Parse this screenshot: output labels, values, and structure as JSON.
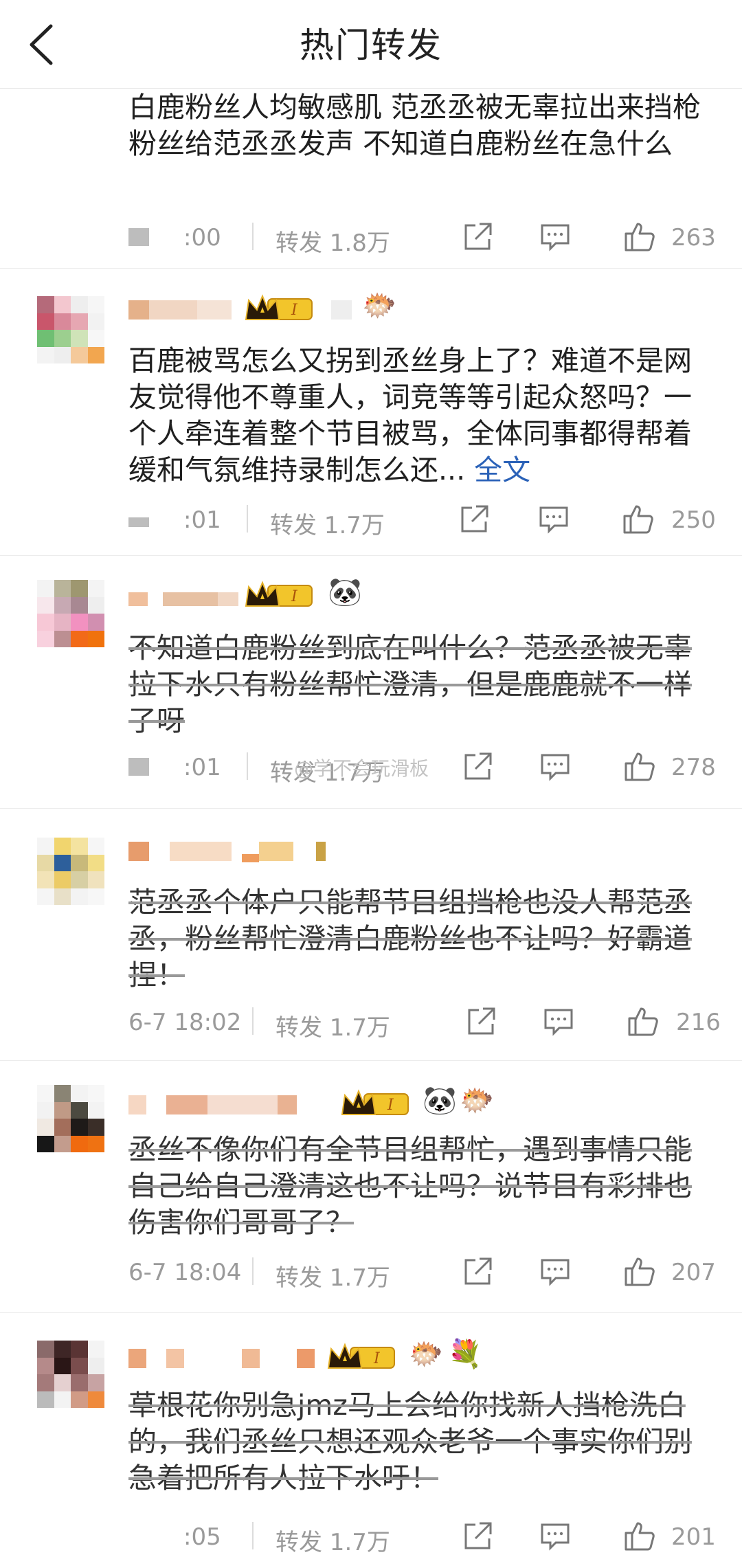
{
  "header": {
    "title": "热门转发"
  },
  "watermark": "@学不会玩滑板",
  "posts": [
    {
      "content": "白鹿粉丝人均敏感肌 范丞丞被无辜拉出来挡枪 粉丝给范丞丞发声 不知道白鹿粉丝在急什么",
      "time": ":00",
      "reposts": "转发 1.8万",
      "likes": "263"
    },
    {
      "content": "百鹿被骂怎么又拐到丞丝身上了？难道不是网友觉得他不尊重人，词竞等等引起众怒吗？一个人牵连着整个节目被骂，全体同事都得帮着缓和气氛维持录制怎么还...",
      "full_text_label": "全文",
      "time": ":01",
      "reposts": "转发 1.7万",
      "likes": "250"
    },
    {
      "content": "不知道白鹿粉丝到底在叫什么？范丞丞被无辜拉下水只有粉丝帮忙澄清，但是鹿鹿就不一样了呀",
      "time": ":01",
      "reposts": "转发 1.7万",
      "likes": "278"
    },
    {
      "content": "范丞丞个体户只能帮节目组挡枪也没人帮范丞丞，粉丝帮忙澄清白鹿粉丝也不让吗？好霸道捏！",
      "time": "6-7 18:02",
      "reposts": "转发 1.7万",
      "likes": "216"
    },
    {
      "content": "丞丝不像你们有全节目组帮忙，遇到事情只能自己给自己澄清这也不让吗？说节目有彩排也伤害你们哥哥了？",
      "time": "6-7 18:04",
      "reposts": "转发 1.7万",
      "likes": "207"
    },
    {
      "content": "草根花你别急jmz马上会给你找新人挡枪洗白的，我们丞丝只想还观众老爷一个事实你们别急着把所有人拉下水吁！",
      "time": ":05",
      "reposts": "转发 1.7万",
      "likes": "201"
    }
  ]
}
